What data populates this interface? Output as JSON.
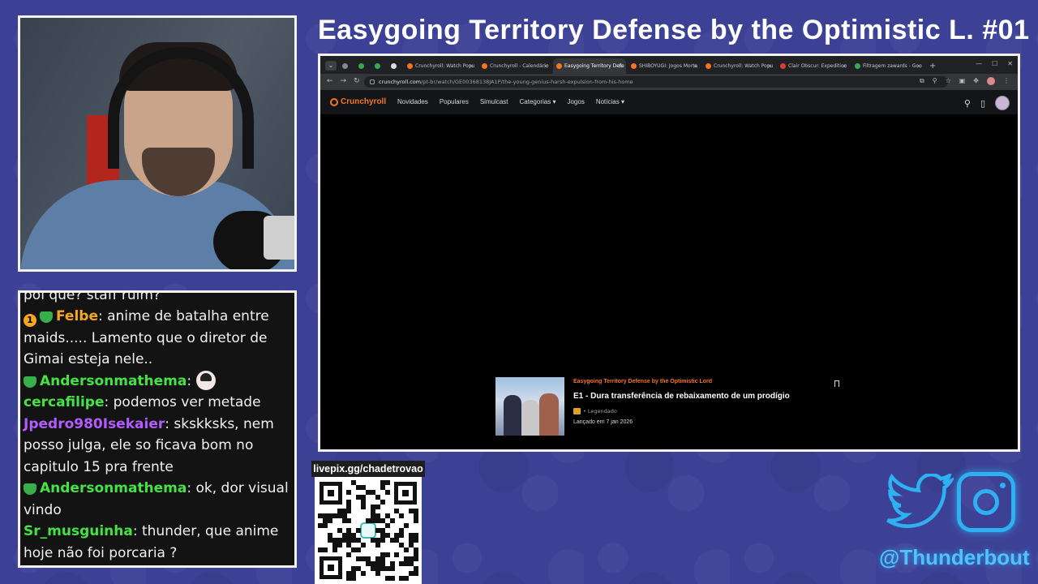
{
  "stream": {
    "title": "Easygoing Territory Defense by the Optimistic L. #01",
    "livepix": "livepix.gg/chadetrovao",
    "social_handle": "@Thunderbout"
  },
  "chat": {
    "messages": [
      {
        "badges": [
          "heart"
        ],
        "user": "Andersonmathema",
        "user_color": "#44e344",
        "text": ": essa porcaria poi que? staff ruim?"
      },
      {
        "badges": [
          "one",
          "heart"
        ],
        "user": "Felbe",
        "user_color": "#f5a623",
        "text": ": anime de batalha entre maids..... Lamento que o diretor de Gimai esteja nele.."
      },
      {
        "badges": [
          "heart"
        ],
        "user": "Andersonmathema",
        "user_color": "#44e344",
        "text": ": ",
        "emote": "anime-girl-emote"
      },
      {
        "badges": [],
        "user": "cercafilipe",
        "user_color": "#44e344",
        "text": ": podemos ver metade"
      },
      {
        "badges": [],
        "user": "Jpedro980Isekaier",
        "user_color": "#b25cff",
        "text": ": skskksks, nem posso julga, ele so ficava bom no capitulo 15 pra frente"
      },
      {
        "badges": [
          "heart"
        ],
        "user": "Andersonmathema",
        "user_color": "#44e344",
        "text": ": ok, dor visual vindo"
      },
      {
        "badges": [],
        "user": "Sr_musguinha",
        "user_color": "#44e344",
        "text": ": thunder, que anime hoje não foi porcaria ?"
      }
    ]
  },
  "browser": {
    "tabs": [
      {
        "label": "",
        "favicon": "#888888",
        "small": true
      },
      {
        "label": "",
        "favicon": "#34a853",
        "small": true
      },
      {
        "label": "",
        "favicon": "#34a853",
        "small": true
      },
      {
        "label": "",
        "favicon": "#dddddd",
        "small": true
      },
      {
        "label": "Crunchyroll: Watch Popu",
        "favicon": "#f47521"
      },
      {
        "label": "Crunchyroll - Calendário",
        "favicon": "#f47521"
      },
      {
        "label": "Easygoing Territory Defe",
        "favicon": "#f47521",
        "active": true
      },
      {
        "label": "SHIBOYUGI: Jogos Morta",
        "favicon": "#f47521"
      },
      {
        "label": "Crunchyroll: Watch Popu",
        "favicon": "#f47521"
      },
      {
        "label": "Clair Obscur: Expedition",
        "favicon": "#e53935"
      },
      {
        "label": "Filtragem zawards - Goo",
        "favicon": "#34a853"
      }
    ],
    "new_tab": "+",
    "url_domain": "crunchyroll.com",
    "url_path": "/pt-br/watch/GE00368138JA1P/the-young-genius-harsh-expulsion-from-his-home",
    "nav": {
      "back": "←",
      "forward": "→",
      "reload": "↻"
    }
  },
  "crunchyroll": {
    "logo": "Crunchyroll",
    "menu": [
      "Novidades",
      "Populares",
      "Simulcast",
      "Categorias ▾",
      "Jogos",
      "Notícias ▾"
    ],
    "episode": {
      "series": "Easygoing Territory Defense by the Optimistic Lord",
      "title": "E1 - Dura transferência de rebaixamento de um prodígio",
      "tag": "• Legendado",
      "date": "Lançado em 7 jan 2026"
    }
  }
}
